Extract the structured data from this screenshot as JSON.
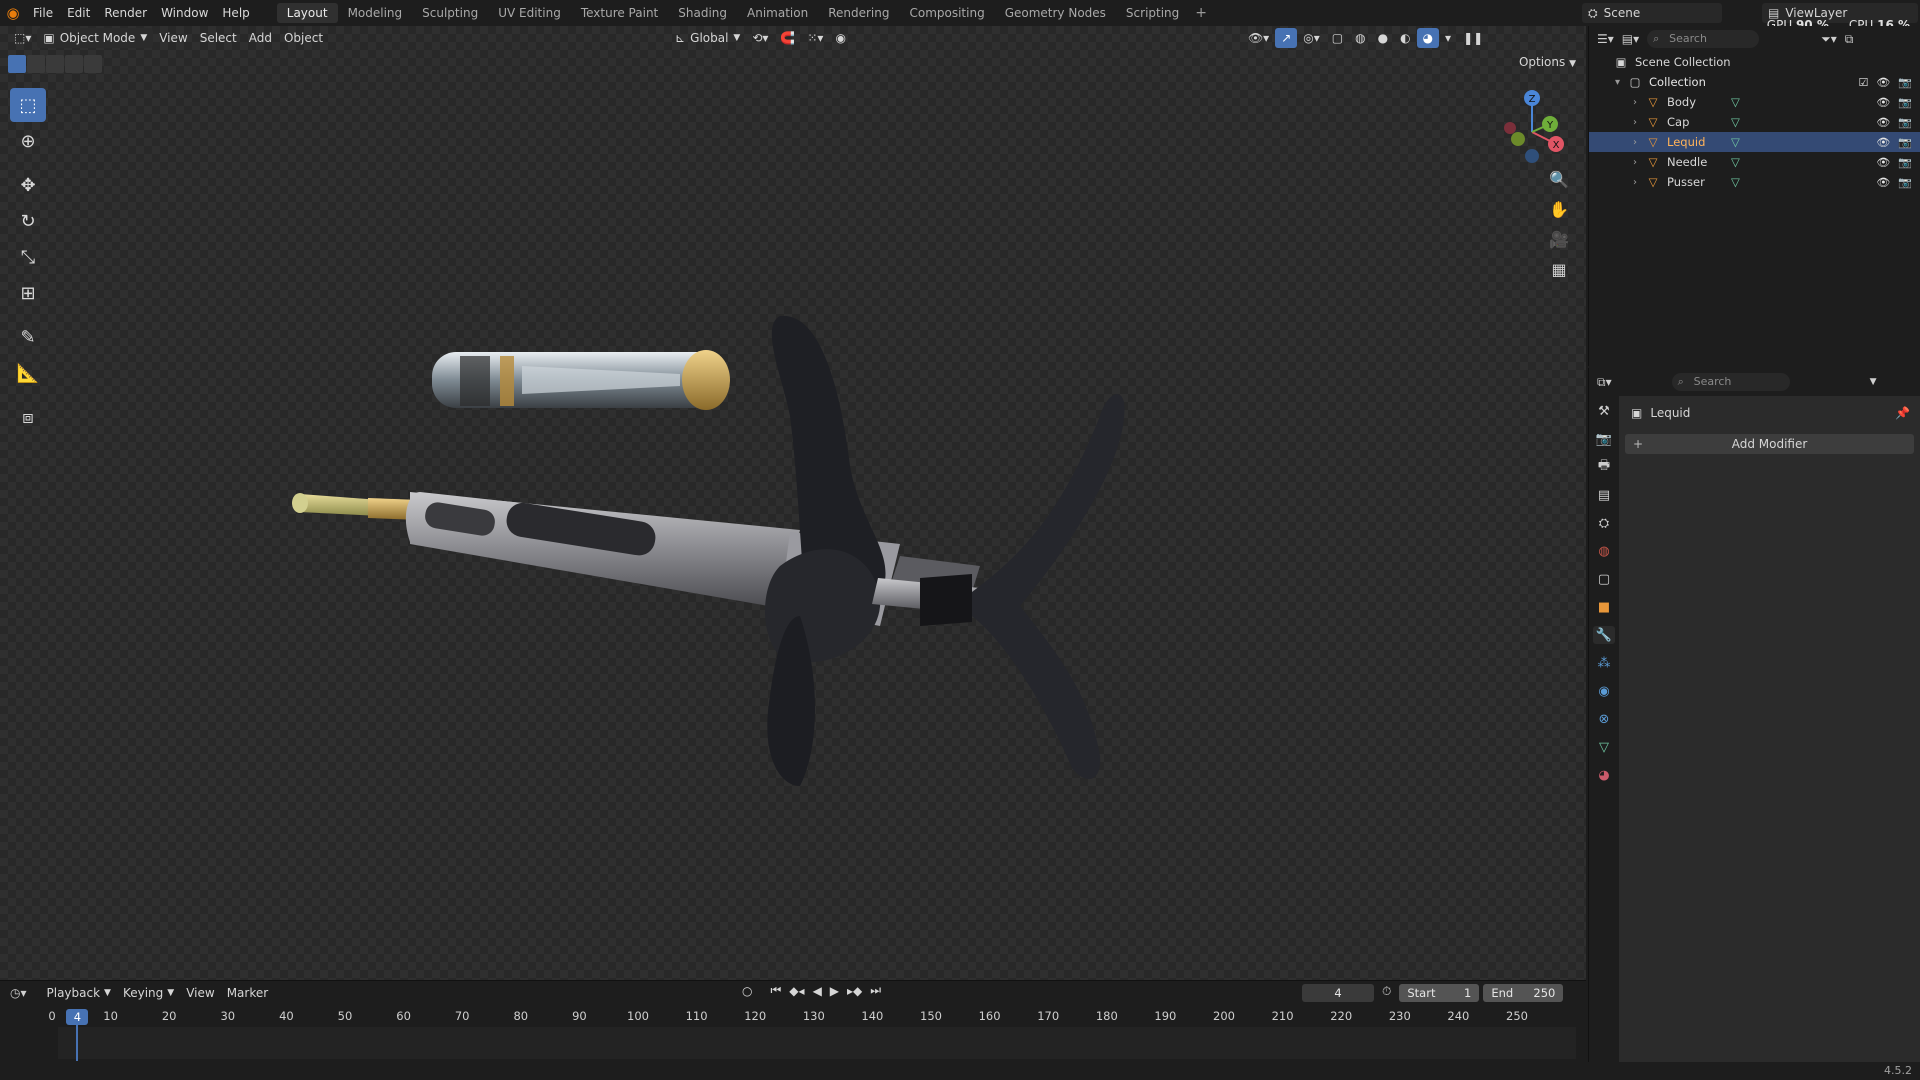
{
  "menu": [
    "File",
    "Edit",
    "Render",
    "Window",
    "Help"
  ],
  "workspaces": [
    "Layout",
    "Modeling",
    "Sculpting",
    "UV Editing",
    "Texture Paint",
    "Shading",
    "Animation",
    "Rendering",
    "Compositing",
    "Geometry Nodes",
    "Scripting"
  ],
  "active_workspace": "Layout",
  "scene_name": "Scene",
  "view_layer": "ViewLayer",
  "stats": {
    "gpu_label": "GPU",
    "gpu_value": "90 %",
    "cpu_label": "CPU",
    "cpu_value": "16 %"
  },
  "viewport": {
    "mode": "Object Mode",
    "menus": [
      "View",
      "Select",
      "Add",
      "Object"
    ],
    "orientation": "Global",
    "options_label": "Options"
  },
  "gizmo_axes": {
    "z": "Z",
    "x": "X",
    "y": "Y"
  },
  "outliner": {
    "search_placeholder": "Search",
    "scene_collection": "Scene Collection",
    "collection": "Collection",
    "objects": [
      "Body",
      "Cap",
      "Lequid",
      "Needle",
      "Pusser"
    ],
    "selected": "Lequid"
  },
  "properties": {
    "search_placeholder": "Search",
    "object_name": "Lequid",
    "add_modifier": "Add Modifier"
  },
  "timeline": {
    "menus": [
      "Playback",
      "Keying",
      "View",
      "Marker"
    ],
    "current_frame": "4",
    "start_label": "Start",
    "start_value": "1",
    "end_label": "End",
    "end_value": "250",
    "ruler": [
      "0",
      "10",
      "20",
      "30",
      "40",
      "50",
      "60",
      "70",
      "80",
      "90",
      "100",
      "110",
      "120",
      "130",
      "140",
      "150",
      "160",
      "170",
      "180",
      "190",
      "200",
      "210",
      "220",
      "230",
      "240",
      "250"
    ]
  },
  "version": "4.5.2",
  "colors": {
    "accent": "#4772b3",
    "selected_row": "#344a74",
    "mesh": "#70c7a1",
    "object": "#e8973a"
  }
}
